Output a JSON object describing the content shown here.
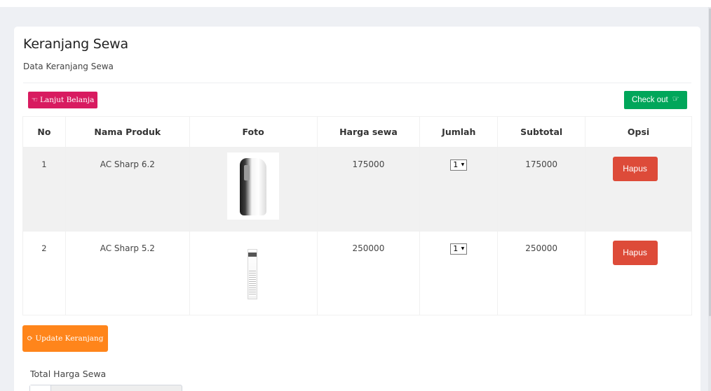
{
  "page": {
    "title": "Keranjang Sewa",
    "subtitle": "Data Keranjang Sewa"
  },
  "toolbar": {
    "continue_label": "Lanjut Belanja",
    "continue_icon": "hand-left-icon",
    "checkout_label": "Check out",
    "checkout_icon": "hand-right-icon"
  },
  "table": {
    "headers": [
      "No",
      "Nama Produk",
      "Foto",
      "Harga sewa",
      "Jumlah",
      "Subtotal",
      "Opsi"
    ],
    "rows": [
      {
        "no": "1",
        "product": "AC Sharp 6.2",
        "photo": "portable-ac-image",
        "price": "175000",
        "qty": "1",
        "subtotal": "175000",
        "action": "Hapus"
      },
      {
        "no": "2",
        "product": "AC Sharp 5.2",
        "photo": "standing-ac-image",
        "price": "250000",
        "qty": "1",
        "subtotal": "250000",
        "action": "Hapus"
      }
    ]
  },
  "footer": {
    "update_label": "Update Keranjang",
    "update_icon": "refresh-icon",
    "total_label": "Total Harga Sewa"
  },
  "colors": {
    "continue_button": "#d81b60",
    "checkout_button": "#00a65a",
    "delete_button": "#dd4b39",
    "update_button": "#ff851b"
  }
}
